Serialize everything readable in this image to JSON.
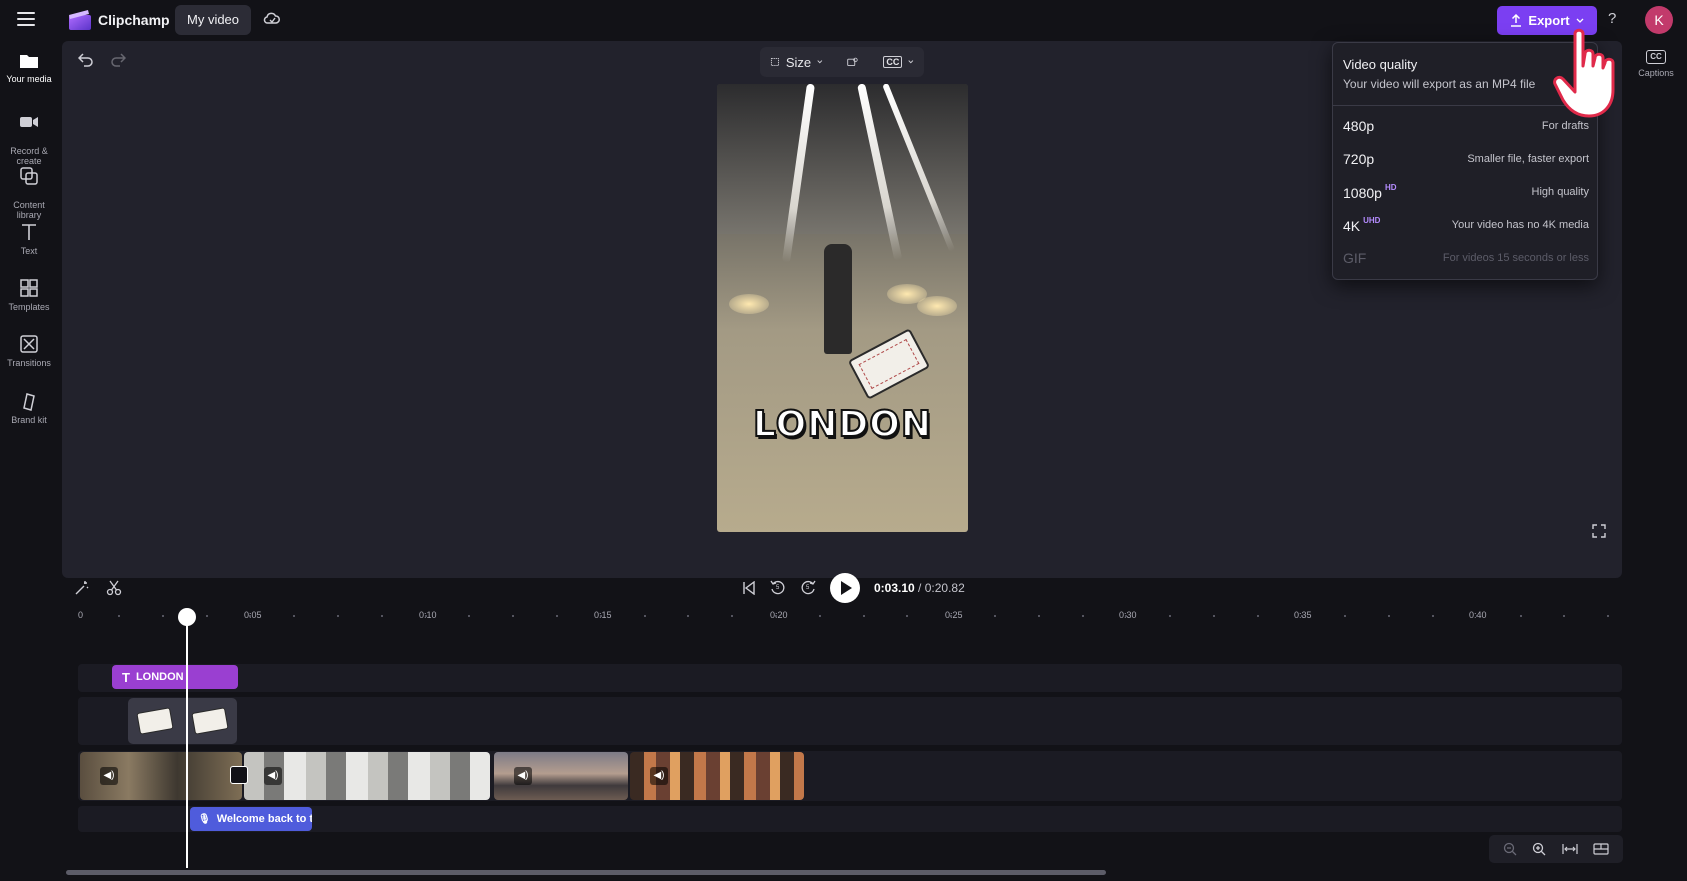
{
  "app": {
    "name": "Clipchamp",
    "project_title": "My video",
    "export_label": "Export",
    "help_label": "?",
    "avatar_initial": "K",
    "accent_color": "#7b3ff2"
  },
  "sidebar": {
    "items": [
      {
        "label": "Your media",
        "icon": "folder-icon"
      },
      {
        "label": "Record &\ncreate",
        "icon": "camera-icon"
      },
      {
        "label": "Content\nlibrary",
        "icon": "library-icon"
      },
      {
        "label": "Text",
        "icon": "text-icon"
      },
      {
        "label": "Templates",
        "icon": "templates-icon"
      },
      {
        "label": "Transitions",
        "icon": "transitions-icon"
      },
      {
        "label": "Brand kit",
        "icon": "brand-kit-icon"
      }
    ]
  },
  "canvas": {
    "size_label": "Size",
    "cc_label": "CC",
    "overlay_text": "LONDON"
  },
  "captions_panel": {
    "label": "Captions",
    "icon_text": "CC"
  },
  "export_dropdown": {
    "title": "Video quality",
    "subtitle": "Your video will export as an MP4 file",
    "options": [
      {
        "resolution": "480p",
        "badge": "",
        "description": "For drafts",
        "enabled": true
      },
      {
        "resolution": "720p",
        "badge": "",
        "description": "Smaller file, faster export",
        "enabled": true
      },
      {
        "resolution": "1080p",
        "badge": "HD",
        "description": "High quality",
        "enabled": true
      },
      {
        "resolution": "4K",
        "badge": "UHD",
        "description": "Your video has no 4K media",
        "enabled": true
      },
      {
        "resolution": "GIF",
        "badge": "",
        "description": "For videos 15 seconds or less",
        "enabled": false
      }
    ]
  },
  "playback": {
    "current_time": "0:03.10",
    "separator": " / ",
    "total_time": "0:20.82",
    "skip_back_label": "5",
    "skip_forward_label": "5"
  },
  "timeline": {
    "ruler_labels": [
      "0",
      "0:05",
      "0:10",
      "0:15",
      "0:20",
      "0:25",
      "0:30",
      "0:35",
      "0:40"
    ],
    "text_clip_label": "LONDON",
    "audio_clip_label": "Welcome back to th"
  }
}
